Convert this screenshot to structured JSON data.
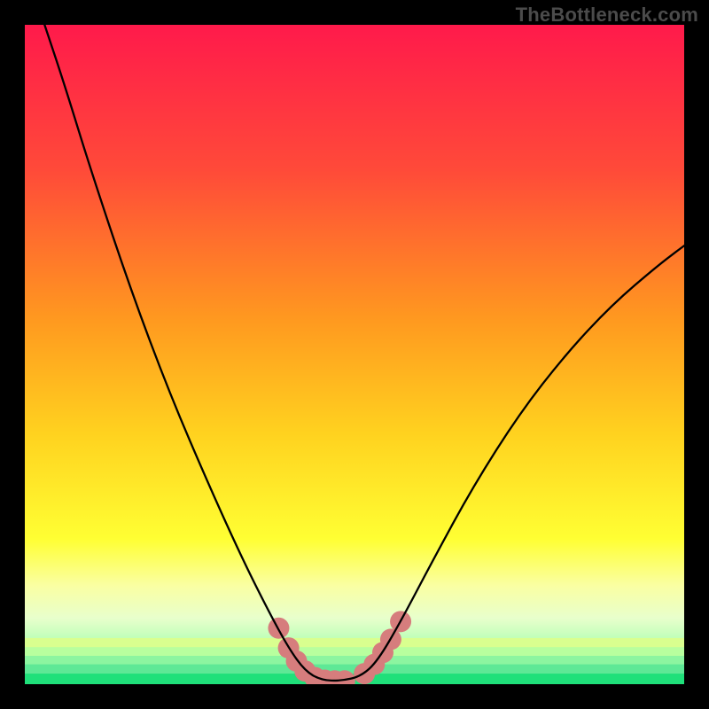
{
  "watermark": "TheBottleneck.com",
  "chart_data": {
    "type": "line",
    "title": "",
    "xlabel": "",
    "ylabel": "",
    "xlim": [
      0,
      100
    ],
    "ylim": [
      0,
      100
    ],
    "background_gradient": {
      "stops": [
        {
          "pos": 0.0,
          "color": "#ff1a4b"
        },
        {
          "pos": 0.22,
          "color": "#ff4a39"
        },
        {
          "pos": 0.45,
          "color": "#ff9a1f"
        },
        {
          "pos": 0.62,
          "color": "#ffd21f"
        },
        {
          "pos": 0.78,
          "color": "#ffff33"
        },
        {
          "pos": 0.85,
          "color": "#faffa2"
        },
        {
          "pos": 0.9,
          "color": "#e8ffcc"
        },
        {
          "pos": 0.94,
          "color": "#b3ffb3"
        },
        {
          "pos": 1.0,
          "color": "#1fe07a"
        }
      ],
      "bottom_bands": [
        {
          "y": 93.0,
          "h": 1.4,
          "color": "#d9ff8f"
        },
        {
          "y": 94.4,
          "h": 1.3,
          "color": "#b8ff9e"
        },
        {
          "y": 95.7,
          "h": 1.3,
          "color": "#8cf5a0"
        },
        {
          "y": 97.0,
          "h": 1.4,
          "color": "#5ee896"
        },
        {
          "y": 98.4,
          "h": 1.6,
          "color": "#1fe07a"
        }
      ]
    },
    "series": [
      {
        "name": "bottleneck-curve",
        "stroke": "#000000",
        "stroke_width": 2.3,
        "points": [
          {
            "x": 3.0,
            "y": 100.0
          },
          {
            "x": 6.0,
            "y": 91.0
          },
          {
            "x": 10.0,
            "y": 78.0
          },
          {
            "x": 16.0,
            "y": 60.0
          },
          {
            "x": 22.0,
            "y": 44.0
          },
          {
            "x": 28.0,
            "y": 30.0
          },
          {
            "x": 33.0,
            "y": 19.0
          },
          {
            "x": 37.0,
            "y": 11.0
          },
          {
            "x": 40.0,
            "y": 5.5
          },
          {
            "x": 42.5,
            "y": 2.0
          },
          {
            "x": 45.0,
            "y": 0.6
          },
          {
            "x": 48.0,
            "y": 0.5
          },
          {
            "x": 51.0,
            "y": 1.2
          },
          {
            "x": 53.5,
            "y": 3.5
          },
          {
            "x": 57.0,
            "y": 9.5
          },
          {
            "x": 62.0,
            "y": 19.0
          },
          {
            "x": 68.0,
            "y": 30.0
          },
          {
            "x": 75.0,
            "y": 41.0
          },
          {
            "x": 82.0,
            "y": 50.0
          },
          {
            "x": 89.0,
            "y": 57.5
          },
          {
            "x": 96.0,
            "y": 63.5
          },
          {
            "x": 100.0,
            "y": 66.5
          }
        ]
      },
      {
        "name": "highlight-markers-left",
        "stroke": "#d67d7d",
        "stroke_width": 12,
        "points": [
          {
            "x": 38.5,
            "y": 8.5
          },
          {
            "x": 40.0,
            "y": 5.5
          },
          {
            "x": 41.2,
            "y": 3.5
          },
          {
            "x": 42.5,
            "y": 2.0
          },
          {
            "x": 44.0,
            "y": 1.0
          },
          {
            "x": 45.5,
            "y": 0.6
          },
          {
            "x": 47.0,
            "y": 0.5
          },
          {
            "x": 48.5,
            "y": 0.5
          }
        ]
      },
      {
        "name": "highlight-markers-right",
        "stroke": "#d67d7d",
        "stroke_width": 12,
        "points": [
          {
            "x": 51.5,
            "y": 1.6
          },
          {
            "x": 53.0,
            "y": 3.0
          },
          {
            "x": 54.3,
            "y": 4.8
          },
          {
            "x": 55.5,
            "y": 6.8
          },
          {
            "x": 57.0,
            "y": 9.5
          }
        ]
      }
    ]
  }
}
